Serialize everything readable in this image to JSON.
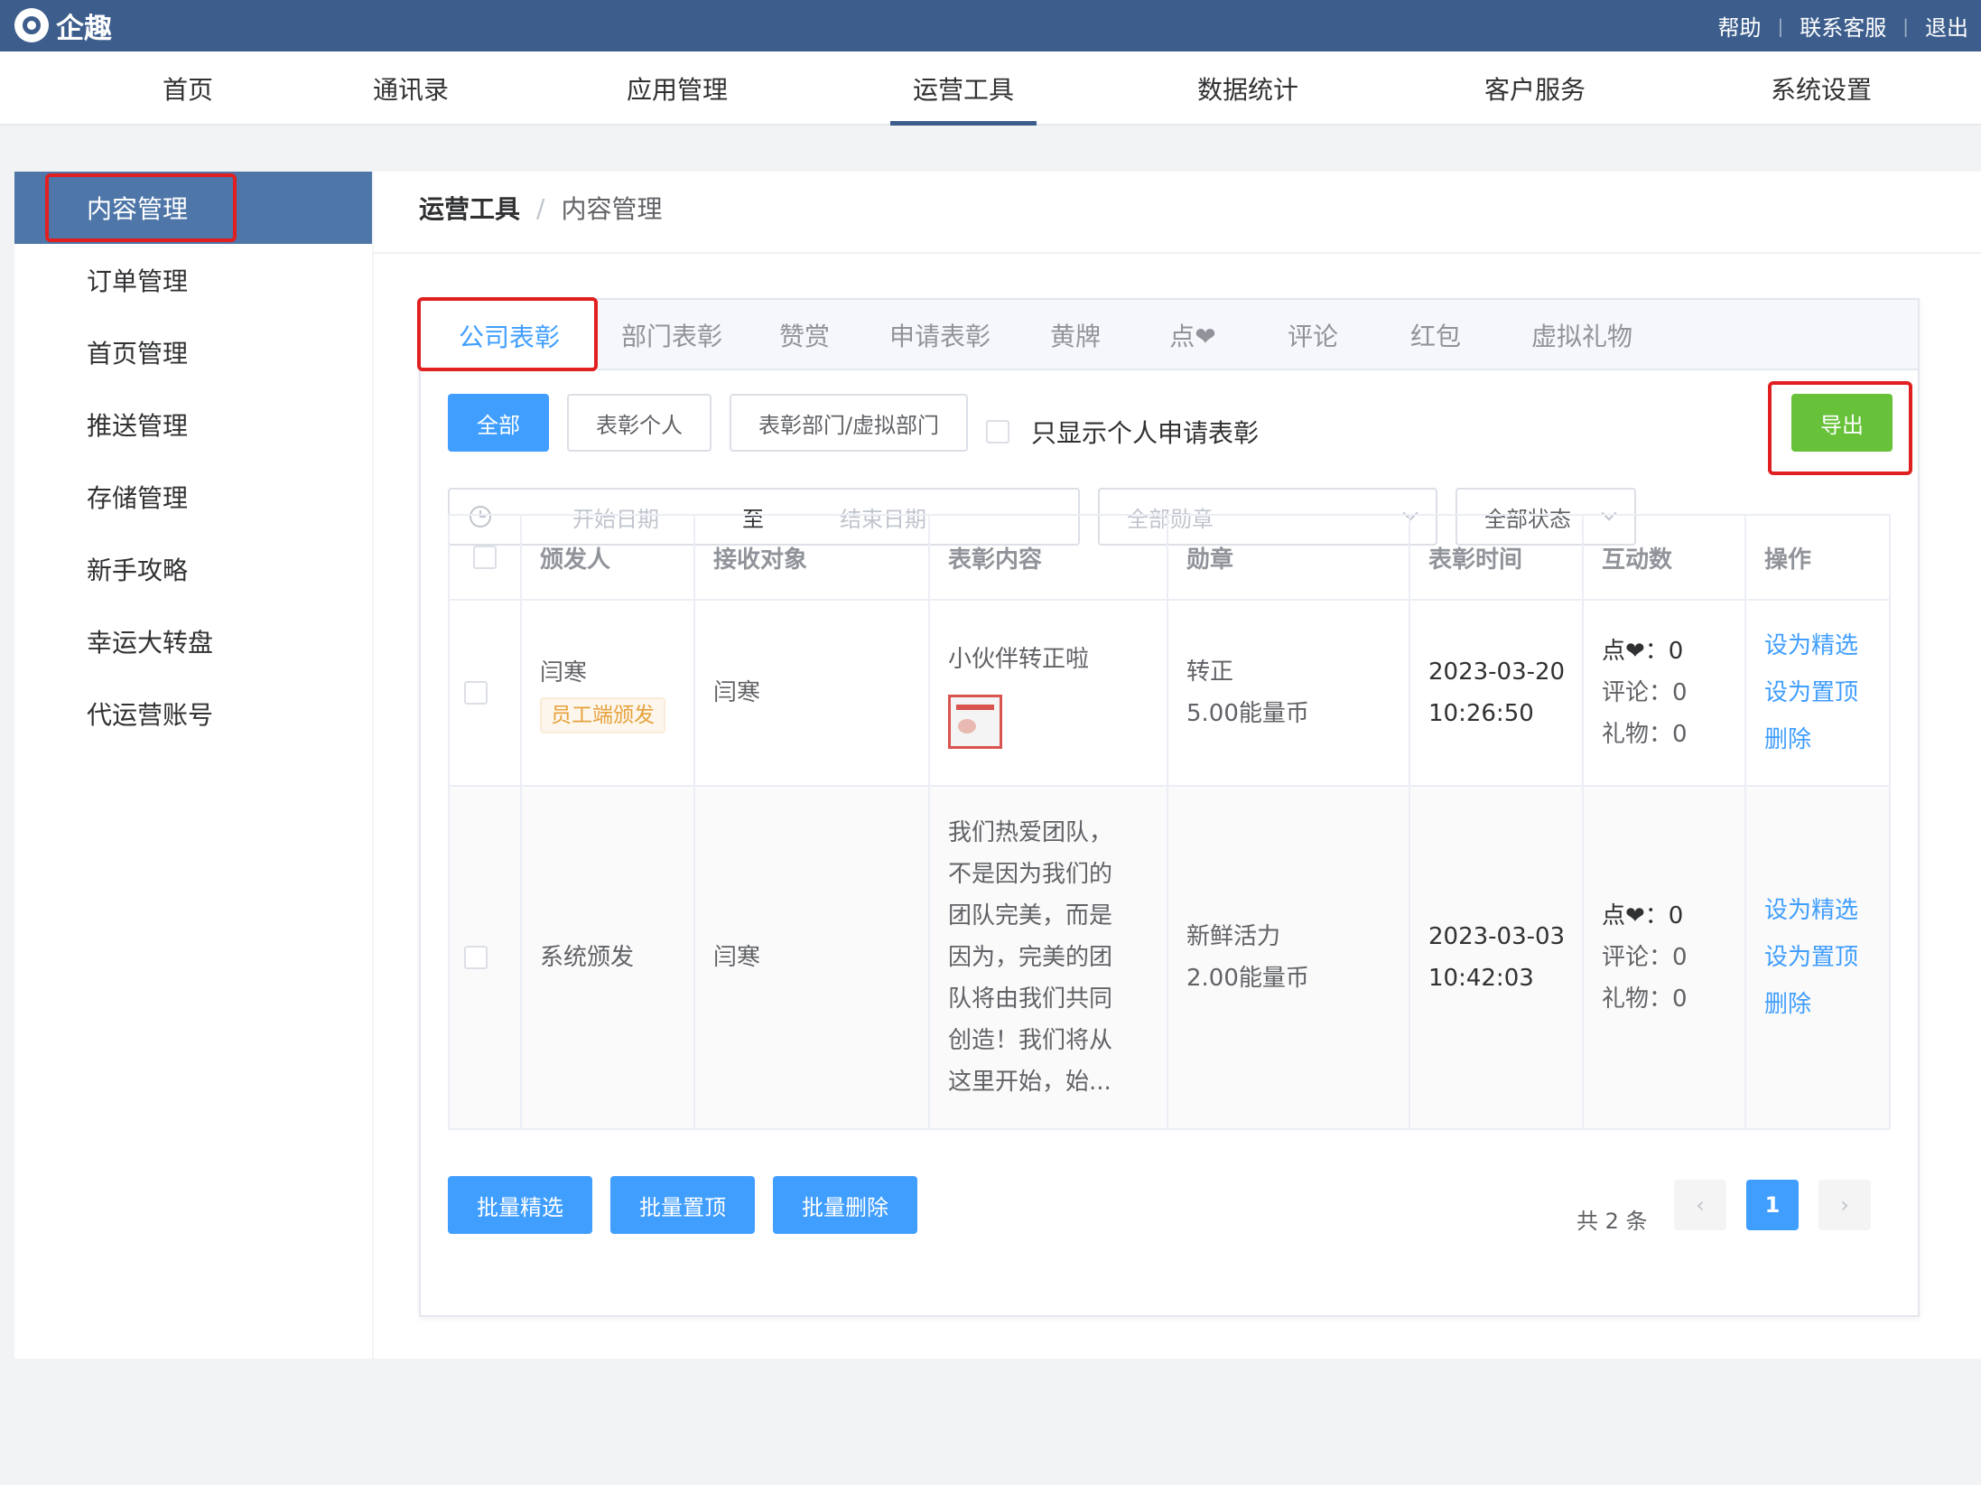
{
  "header": {
    "logo_text": "企趣",
    "links": [
      "帮助",
      "联系客服",
      "退出"
    ]
  },
  "nav": {
    "items": [
      "首页",
      "通讯录",
      "应用管理",
      "运营工具",
      "数据统计",
      "客户服务",
      "系统设置"
    ],
    "active": "运营工具"
  },
  "sidebar": {
    "items": [
      "内容管理",
      "订单管理",
      "首页管理",
      "推送管理",
      "存储管理",
      "新手攻略",
      "幸运大转盘",
      "代运营账号"
    ],
    "active": "内容管理"
  },
  "breadcrumb": {
    "parent": "运营工具",
    "sep": "/",
    "current": "内容管理"
  },
  "tabs": {
    "items": [
      "公司表彰",
      "部门表彰",
      "赞赏",
      "申请表彰",
      "黄牌",
      "点❤",
      "评论",
      "红包",
      "虚拟礼物"
    ],
    "active": "公司表彰"
  },
  "filters": {
    "type_buttons": [
      "全部",
      "表彰个人",
      "表彰部门/虚拟部门"
    ],
    "only_personal_label": "只显示个人申请表彰",
    "export_label": "导出",
    "date_start_placeholder": "开始日期",
    "date_sep": "至",
    "date_end_placeholder": "结束日期",
    "medal_placeholder": "全部勋章",
    "status_value": "全部状态"
  },
  "table": {
    "columns": [
      "颁发人",
      "接收对象",
      "表彰内容",
      "勋章",
      "表彰时间",
      "互动数",
      "操作"
    ],
    "rows": [
      {
        "issuer": "闫寒",
        "issuer_tag": "员工端颁发",
        "receiver": "闫寒",
        "content": "小伙伴转正啦",
        "medal_name": "转正",
        "medal_coins": "5.00能量币",
        "date": "2023-03-20",
        "time": "10:26:50",
        "likes": "点❤：0",
        "comments": "评论：0",
        "gifts": "礼物：0"
      },
      {
        "issuer": "系统颁发",
        "issuer_tag": "",
        "receiver": "闫寒",
        "content_lines": [
          "我们热爱团队，",
          "不是因为我们的",
          "团队完美，而是",
          "因为，完美的团",
          "队将由我们共同",
          "创造！我们将从",
          "这里开始，始..."
        ],
        "medal_name": "新鲜活力",
        "medal_coins": "2.00能量币",
        "date": "2023-03-03",
        "time": "10:42:03",
        "likes": "点❤：0",
        "comments": "评论：0",
        "gifts": "礼物：0"
      }
    ],
    "actions": [
      "设为精选",
      "设为置顶",
      "删除"
    ]
  },
  "batch": [
    "批量精选",
    "批量置顶",
    "批量删除"
  ],
  "pager": {
    "total": "共 2 条",
    "current": "1",
    "prev": "‹",
    "next": "›"
  },
  "colors": {
    "topbar": "#3d5e8c",
    "sidebar_active": "#4e76a8",
    "primary": "#409eff",
    "success": "#67c23a",
    "highlight_box": "#e02020"
  }
}
